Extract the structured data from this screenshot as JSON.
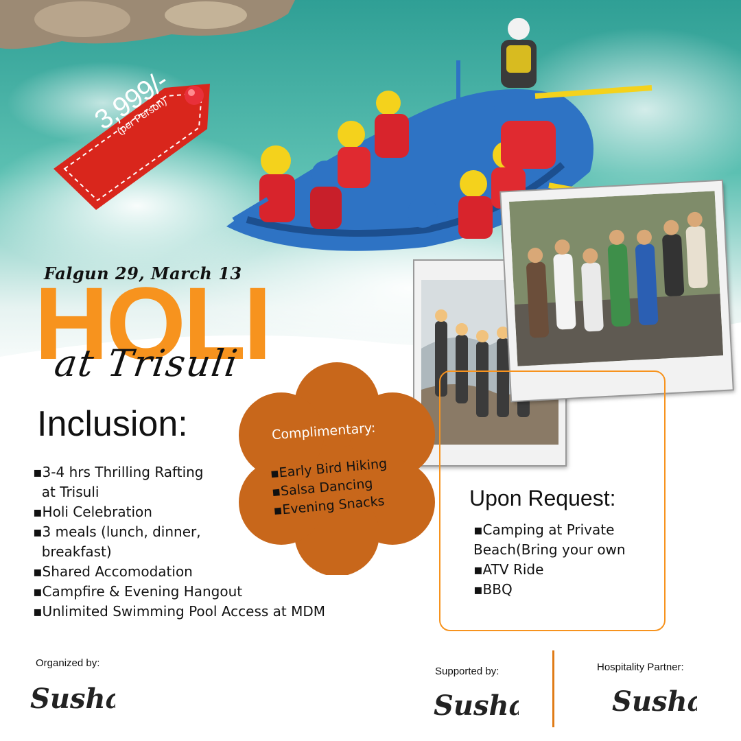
{
  "price": {
    "amount": "3,999/-",
    "unit": "(per Person)"
  },
  "event": {
    "date": "Falgun 29, March 13",
    "title": "HOLI",
    "subtitle": "at Trisuli"
  },
  "inclusion": {
    "title": "Inclusion:",
    "items": [
      "▪3-4 hrs Thrilling Rafting\n  at Trisuli",
      "▪Holi Celebration",
      "▪3 meals (lunch, dinner,\n  breakfast)",
      "▪Shared Accomodation",
      "▪Campfire & Evening Hangout",
      "▪Unlimited Swimming Pool Access at MDM"
    ]
  },
  "complimentary": {
    "title": "Complimentary:",
    "items": [
      "▪Early Bird Hiking",
      "▪Salsa Dancing",
      "▪Evening Snacks"
    ]
  },
  "upon_request": {
    "title": "Upon Request:",
    "items": [
      "▪Camping at Private\nBeach(Bring your own",
      "▪ATV Ride",
      "▪BBQ"
    ]
  },
  "footer": {
    "organized_label": "Organized by:",
    "supported_label": "Supported by:",
    "hospitality_label": "Hospitality Partner:",
    "logo_text": "Sushan"
  },
  "colors": {
    "accent_orange": "#f7931e",
    "tag_red": "#d9261c",
    "flower_brown": "#c8671b",
    "river": "#2aa59a"
  }
}
